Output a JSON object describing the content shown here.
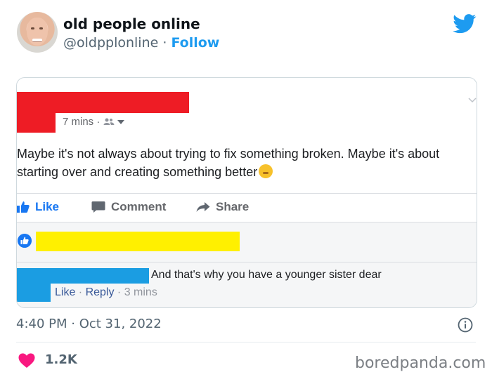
{
  "tweet": {
    "author_name": "old people online",
    "handle": "@oldpplonline",
    "separator": " · ",
    "follow_label": "Follow",
    "timestamp": "4:40 PM · Oct 31, 2022",
    "like_count": "1.2K"
  },
  "facebook_post": {
    "time": "7 mins ·",
    "text": "Maybe it's not always about trying to fix something broken. Maybe it's about starting over and creating something better",
    "actions": {
      "like": "Like",
      "comment": "Comment",
      "share": "Share"
    },
    "reply": {
      "text": "And that's why you have a younger sister dear",
      "like": "Like",
      "sep1": " · ",
      "reply": "Reply",
      "sep2": " · ",
      "time": "3 mins"
    }
  },
  "watermark": "boredpanda.com",
  "colors": {
    "twitter_blue": "#1d9bf0",
    "facebook_blue": "#1877f2",
    "redaction_red": "#ee1c25",
    "redaction_yellow": "#fff000",
    "redaction_blue": "#1b9de2",
    "heart": "#f91880"
  },
  "icons": [
    "avatar",
    "twitter-bird-icon",
    "audience-icon",
    "chevron-down-icon",
    "like-thumb-icon",
    "comment-icon",
    "share-arrow-icon",
    "info-icon",
    "heart-icon",
    "grimace-emoji-icon"
  ]
}
